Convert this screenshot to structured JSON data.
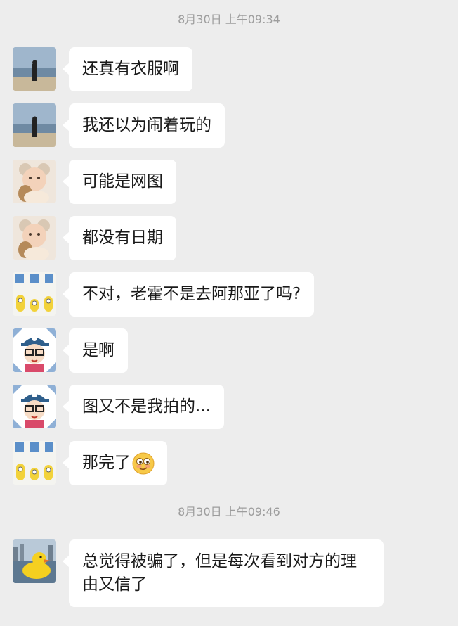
{
  "timestamps": [
    "8月30日 上午09:34",
    "8月30日 上午09:46"
  ],
  "messages": [
    {
      "avatar": "beach-man-avatar",
      "text": "还真有衣服啊"
    },
    {
      "avatar": "beach-man-avatar",
      "text": "我还以为闹着玩的"
    },
    {
      "avatar": "baby-avatar",
      "text": "可能是网图"
    },
    {
      "avatar": "baby-avatar",
      "text": "都没有日期"
    },
    {
      "avatar": "minions-avatar",
      "text": "不对，老霍不是去阿那亚了吗?"
    },
    {
      "avatar": "cartoon-boy-avatar",
      "text": "是啊"
    },
    {
      "avatar": "cartoon-boy-avatar",
      "text": "图又不是我拍的..."
    },
    {
      "avatar": "minions-avatar",
      "text": "那完了"
    },
    {
      "avatar": "yellow-duck-avatar",
      "text": "总觉得被骗了，但是每次看到对方的理由又信了"
    }
  ],
  "colors": {
    "background": "#ededed",
    "bubble": "#ffffff",
    "timestamp": "#9d9d9d"
  },
  "icons": {
    "smirk_emoji": "smirk-emoji-icon"
  }
}
